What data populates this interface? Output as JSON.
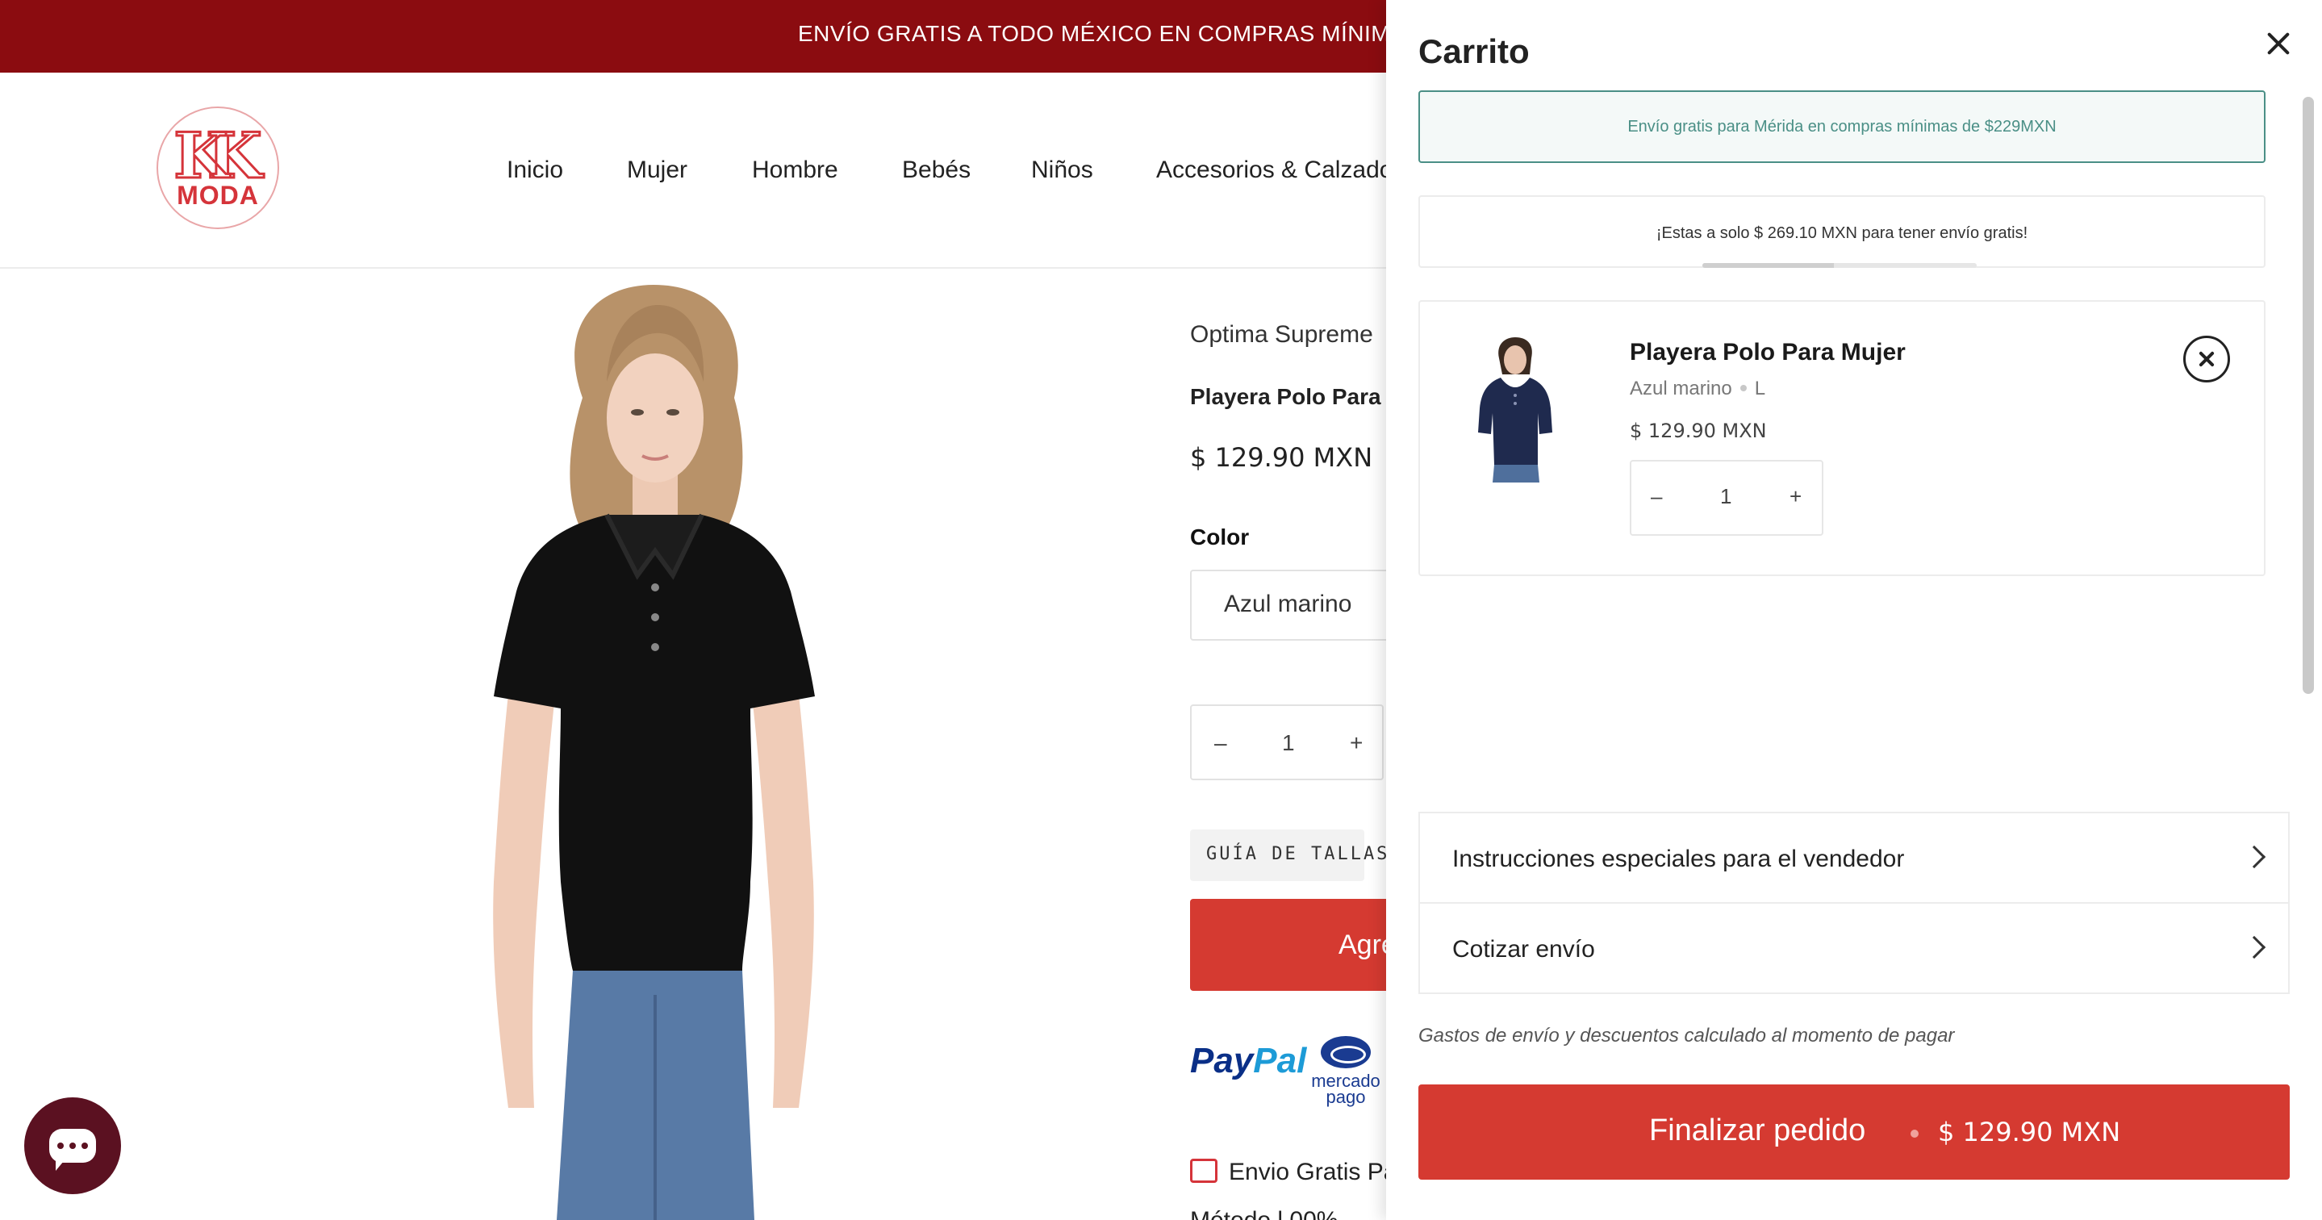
{
  "announcement": "ENVÍO GRATIS A TODO MÉXICO EN COMPRAS MÍNIMAS DE",
  "logo": {
    "text": "MODA"
  },
  "nav": [
    "Inicio",
    "Mujer",
    "Hombre",
    "Bebés",
    "Niños",
    "Accesorios & Calzado"
  ],
  "product": {
    "vendor": "Optima Supreme",
    "title": "Playera Polo Para M",
    "price": "$ 129.90 MXN",
    "color_label": "Color",
    "color_value": "Azul marino",
    "quantity": "1",
    "size_guide": "GUÍA DE TALLAS",
    "add_to_cart": "Agre",
    "payments": {
      "paypal_a": "Pay",
      "paypal_b": "Pal",
      "mercadopago": "mercado pago"
    },
    "shipping_line": "Envio Gratis Pa",
    "secure_line": "Método l 00%"
  },
  "cart": {
    "title": "Carrito",
    "free_shipping_notice": "Envío gratis para Mérida en compras mínimas de $229MXN",
    "progress_text": "¡Estas a solo $ 269.10 MXN para tener envío gratis!",
    "progress_fraction": 0.48,
    "item": {
      "name": "Playera Polo Para Mujer",
      "color": "Azul marino",
      "size": "L",
      "price": "$ 129.90 MXN",
      "quantity": "1"
    },
    "instructions_label": "Instrucciones especiales para el vendedor",
    "shipping_quote_label": "Cotizar envío",
    "note": "Gastos de envío y descuentos calculado al momento de pagar",
    "checkout_label": "Finalizar pedido",
    "checkout_total": "$ 129.90 MXN"
  },
  "colors": {
    "announcement_bg": "#8b0c10",
    "accent_red": "#d53a31",
    "notice_green": "#4a8f86",
    "chat_bg": "#5b1121"
  }
}
